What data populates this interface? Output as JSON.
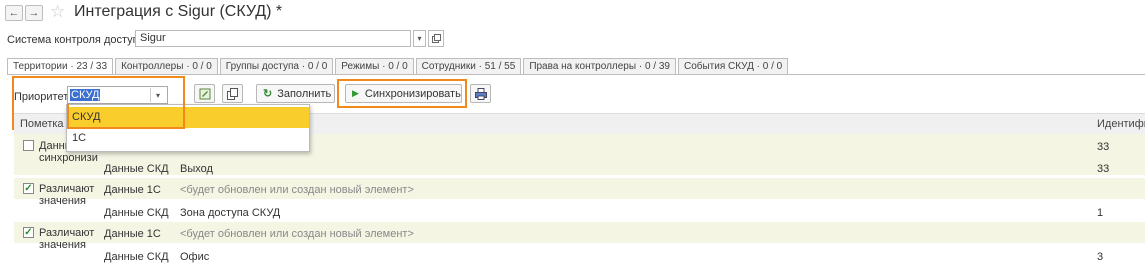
{
  "window": {
    "title": "Интеграция с Sigur (СКУД) *",
    "back_icon": "←",
    "forward_icon": "→",
    "star_icon": "☆"
  },
  "system": {
    "label": "Система контроля доступа:",
    "value": "Sigur"
  },
  "tabs": [
    {
      "label": "Территории · 23 / 33",
      "active": true
    },
    {
      "label": "Контроллеры · 0 / 0"
    },
    {
      "label": "Группы доступа · 0 / 0"
    },
    {
      "label": "Режимы · 0 / 0"
    },
    {
      "label": "Сотрудники · 51 / 55"
    },
    {
      "label": "Права на контроллеры · 0 / 39"
    },
    {
      "label": "События СКУД · 0 / 0"
    }
  ],
  "toolbar": {
    "priority_label": "Приоритет:",
    "priority_value": "СКУД",
    "fill_label": "Заполнить",
    "sync_label": "Синхронизировать"
  },
  "dropdown": {
    "options": [
      "СКУД",
      "1С"
    ],
    "selected": "СКУД"
  },
  "table": {
    "headers": {
      "mark": "Пометка",
      "id": "Идентифик"
    },
    "rows": [
      {
        "checked": false,
        "mark": "Данные",
        "mark2": "синхронизи",
        "src1": "",
        "val1": "",
        "id1": "33",
        "src2": "Данные СКД",
        "val2": "Выход",
        "id2": "33"
      },
      {
        "checked": true,
        "mark": "Различают",
        "mark2": "значения",
        "src1": "Данные 1С",
        "val1": "<будет обновлен или создан новый элемент>",
        "id1": "",
        "src2": "Данные СКД",
        "val2": "Зона доступа СКУД",
        "id2": "1"
      },
      {
        "checked": true,
        "mark": "Различают",
        "mark2": "значения",
        "src1": "Данные 1С",
        "val1": "<будет обновлен или создан новый элемент>",
        "id1": "",
        "src2": "Данные СКД",
        "val2": "Офис",
        "id2": "3"
      }
    ]
  },
  "colors": {
    "highlight": "#f08a1c",
    "row_tint": "#f5f5e4",
    "selected_option": "#f9cd2c"
  }
}
